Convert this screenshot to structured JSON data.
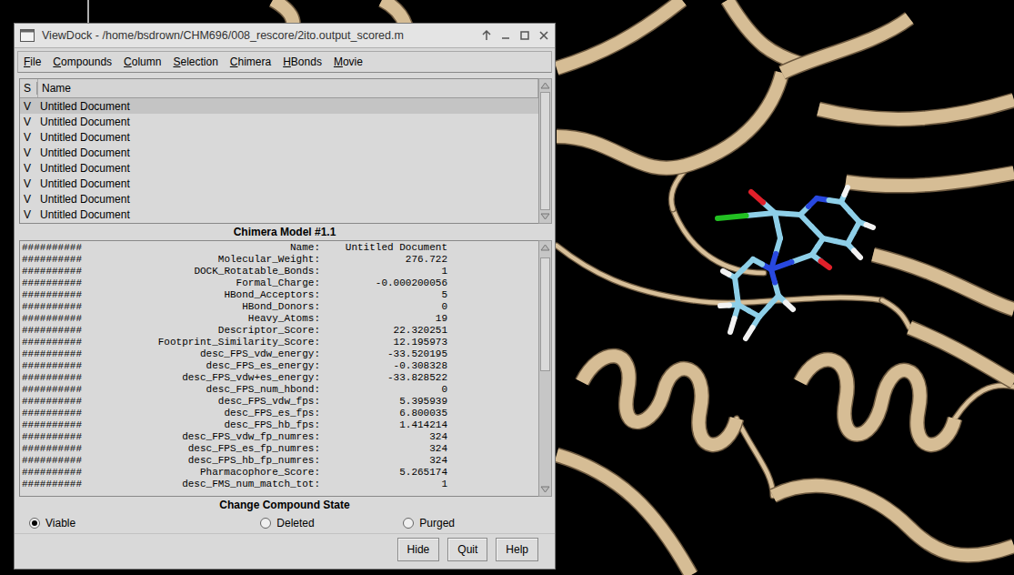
{
  "window": {
    "title": "ViewDock - /home/bsdrown/CHM696/008_rescore/2ito.output_scored.m"
  },
  "menu": [
    "File",
    "Compounds",
    "Column",
    "Selection",
    "Chimera",
    "HBonds",
    "Movie"
  ],
  "list": {
    "columns": [
      "S",
      "Name"
    ],
    "rows": [
      {
        "state": "V",
        "name": "Untitled Document",
        "selected": true
      },
      {
        "state": "V",
        "name": "Untitled Document",
        "selected": false
      },
      {
        "state": "V",
        "name": "Untitled Document",
        "selected": false
      },
      {
        "state": "V",
        "name": "Untitled Document",
        "selected": false
      },
      {
        "state": "V",
        "name": "Untitled Document",
        "selected": false
      },
      {
        "state": "V",
        "name": "Untitled Document",
        "selected": false
      },
      {
        "state": "V",
        "name": "Untitled Document",
        "selected": false
      },
      {
        "state": "V",
        "name": "Untitled Document",
        "selected": false
      }
    ]
  },
  "detail": {
    "title": "Chimera Model #1.1",
    "rows": [
      {
        "hash": "##########",
        "key": "Name:",
        "value": "Untitled Document"
      },
      {
        "hash": "##########",
        "key": "Molecular_Weight:",
        "value": "276.722"
      },
      {
        "hash": "##########",
        "key": "DOCK_Rotatable_Bonds:",
        "value": "1"
      },
      {
        "hash": "##########",
        "key": "Formal_Charge:",
        "value": "-0.000200056"
      },
      {
        "hash": "##########",
        "key": "HBond_Acceptors:",
        "value": "5"
      },
      {
        "hash": "##########",
        "key": "HBond_Donors:",
        "value": "0"
      },
      {
        "hash": "##########",
        "key": "Heavy_Atoms:",
        "value": "19"
      },
      {
        "hash": "##########",
        "key": "Descriptor_Score:",
        "value": "22.320251"
      },
      {
        "hash": "##########",
        "key": "Footprint_Similarity_Score:",
        "value": "12.195973"
      },
      {
        "hash": "##########",
        "key": "desc_FPS_vdw_energy:",
        "value": "-33.520195"
      },
      {
        "hash": "##########",
        "key": "desc_FPS_es_energy:",
        "value": "-0.308328"
      },
      {
        "hash": "##########",
        "key": "desc_FPS_vdw+es_energy:",
        "value": "-33.828522"
      },
      {
        "hash": "##########",
        "key": "desc_FPS_num_hbond:",
        "value": "0"
      },
      {
        "hash": "##########",
        "key": "desc_FPS_vdw_fps:",
        "value": "5.395939"
      },
      {
        "hash": "##########",
        "key": "desc_FPS_es_fps:",
        "value": "6.800035"
      },
      {
        "hash": "##########",
        "key": "desc_FPS_hb_fps:",
        "value": "1.414214"
      },
      {
        "hash": "##########",
        "key": "desc_FPS_vdw_fp_numres:",
        "value": "324"
      },
      {
        "hash": "##########",
        "key": "desc_FPS_es_fp_numres:",
        "value": "324"
      },
      {
        "hash": "##########",
        "key": "desc_FPS_hb_fp_numres:",
        "value": "324"
      },
      {
        "hash": "##########",
        "key": "Pharmacophore_Score:",
        "value": "5.265174"
      },
      {
        "hash": "##########",
        "key": "desc_FMS_num_match_tot:",
        "value": "1"
      }
    ]
  },
  "state_panel": {
    "title": "Change Compound State",
    "options": [
      {
        "label": "Viable",
        "selected": true
      },
      {
        "label": "Deleted",
        "selected": false
      },
      {
        "label": "Purged",
        "selected": false
      }
    ]
  },
  "buttons": [
    "Hide",
    "Quit",
    "Help"
  ]
}
